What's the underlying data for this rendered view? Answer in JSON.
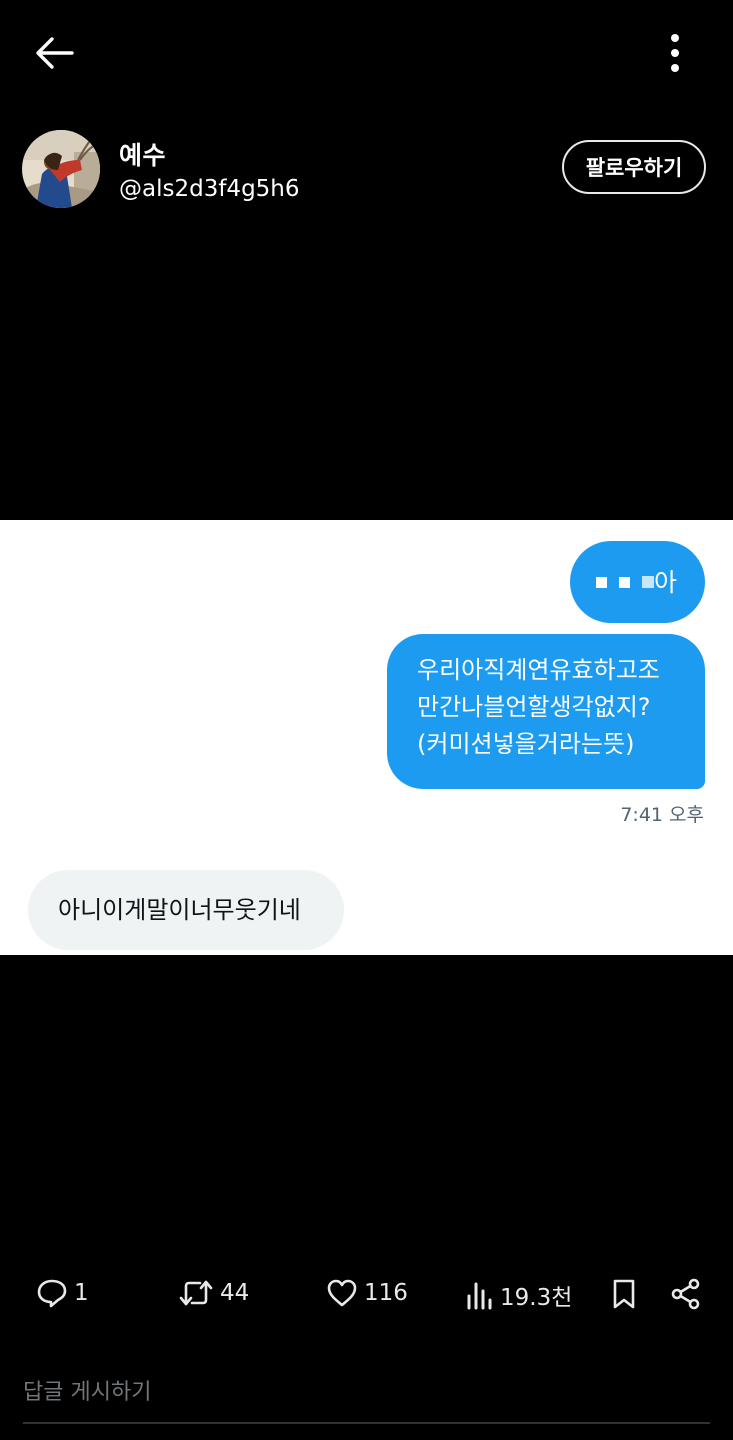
{
  "header": {
    "back_icon": "arrow-left-icon",
    "more_icon": "more-vertical-icon"
  },
  "author": {
    "name": "예수",
    "handle": "@als2d3f4g5h6",
    "follow_label": "팔로우하기"
  },
  "chat": {
    "bubble1_visible_text": "아",
    "bubble2_text": "우리아직계연유효하고조\n만간나블언할생각없지?\n(커미션넣을거라는뜻)",
    "timestamp": "7:41 오후",
    "bubble3_text": "아니이게말이너무웃기네",
    "colors": {
      "sent": "#1d9bf0",
      "received": "#eff3f4"
    }
  },
  "actions": {
    "replies": "1",
    "retweets": "44",
    "likes": "116",
    "views": "19.3천"
  },
  "reply_box": {
    "placeholder": "답글 게시하기"
  }
}
